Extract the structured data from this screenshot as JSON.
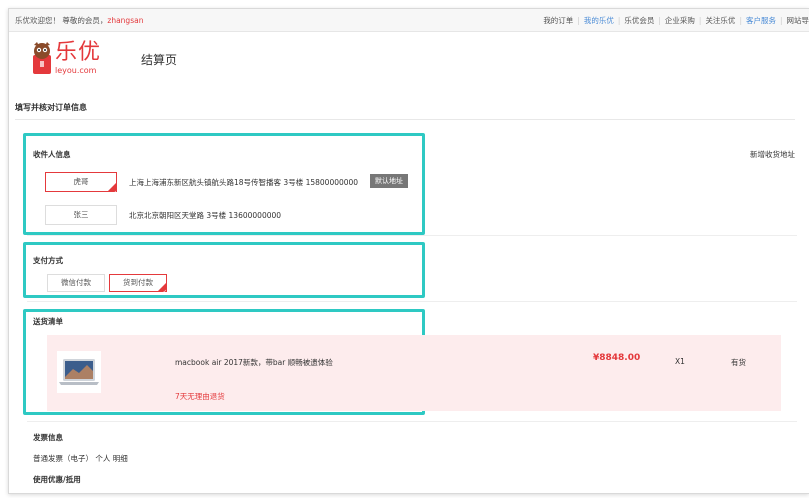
{
  "topbar": {
    "welcome": "乐优欢迎您！ 尊敬的会员，",
    "username": "zhangsan",
    "nav": [
      {
        "label": "我的订单",
        "active": false
      },
      {
        "label": "我的乐优",
        "active": true
      },
      {
        "label": "乐优会员",
        "active": false
      },
      {
        "label": "企业采购",
        "active": false
      },
      {
        "label": "关注乐优",
        "active": false
      },
      {
        "label": "客户服务",
        "active": true
      },
      {
        "label": "网站导",
        "active": false
      }
    ]
  },
  "logo": {
    "text": "乐优",
    "domain": "leyou.com"
  },
  "page_title": "结算页",
  "section_title": "填写并核对订单信息",
  "receiver": {
    "title": "收件人信息",
    "new_address": "新增收货地址",
    "addresses": [
      {
        "name": "虎哥",
        "detail": "上海上海浦东新区航头镇航头路18号传智播客 3号楼 15800000000",
        "selected": true,
        "default_label": "默认地址"
      },
      {
        "name": "张三",
        "detail": "北京北京朝阳区天堂路 3号楼 13600000000",
        "selected": false,
        "default_label": ""
      }
    ]
  },
  "payment": {
    "title": "支付方式",
    "options": [
      {
        "label": "微信付款",
        "selected": false
      },
      {
        "label": "货到付款",
        "selected": true
      }
    ]
  },
  "goods": {
    "title": "送货清单",
    "items": [
      {
        "name": "macbook air 2017新款，带bar 顺畅被遗体验",
        "price": "¥8848.00",
        "qty": "X1",
        "stock": "有货",
        "promise": "7天无理由退货"
      }
    ]
  },
  "invoice": {
    "title": "发票信息",
    "detail": "普通发票（电子） 个人 明细"
  },
  "coupon": {
    "title": "使用优惠/抵用"
  },
  "colors": {
    "accent": "#e4393c",
    "highlight": "#2ec9c3",
    "link": "#4a8bd6",
    "goods_bg": "#fdeced"
  }
}
